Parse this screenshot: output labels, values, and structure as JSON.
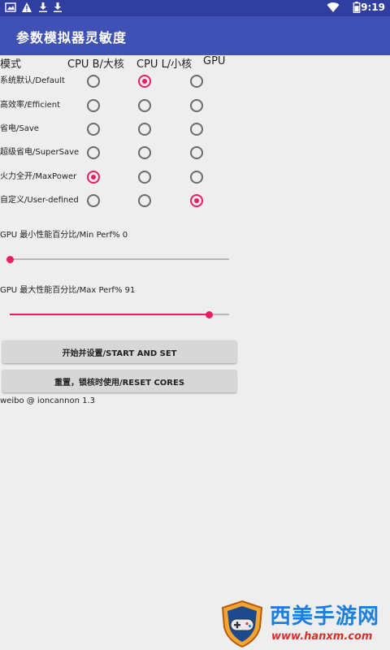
{
  "status_bar": {
    "time": "9:19",
    "left_icons": [
      "image-icon",
      "warning-icon",
      "download-icon",
      "download-icon"
    ],
    "right_icons": [
      "wifi-icon",
      "battery-icon"
    ]
  },
  "app_bar": {
    "title": "参数模拟器灵敏度"
  },
  "mode_table": {
    "headers": [
      "模式",
      "CPU B/大核",
      "CPU L/小核",
      "GPU"
    ],
    "rows": [
      {
        "label": "系统默认/Default",
        "selected": [
          false,
          true,
          false
        ]
      },
      {
        "label": "高效率/Efficient",
        "selected": [
          false,
          false,
          false
        ]
      },
      {
        "label": "省电/Save",
        "selected": [
          false,
          false,
          false
        ]
      },
      {
        "label": "超级省电/SuperSave",
        "selected": [
          false,
          false,
          false
        ]
      },
      {
        "label": "火力全开/MaxPower",
        "selected": [
          true,
          false,
          false
        ]
      },
      {
        "label": "自定义/User-defined",
        "selected": [
          false,
          false,
          true
        ]
      }
    ]
  },
  "sliders": [
    {
      "label": "GPU 最小性能百分比/Min Perf% 0",
      "value_percent": 0
    },
    {
      "label": "GPU 最大性能百分比/Max Perf% 91",
      "value_percent": 91
    }
  ],
  "buttons": {
    "start_set": "开始并设置/START AND SET",
    "reset_cores": "重置，锁核时使用/RESET CORES"
  },
  "footer": {
    "version": "weibo @ ioncannon 1.3"
  },
  "watermark": {
    "name": "西美手游网",
    "url": "www.hanxm.com"
  },
  "colors": {
    "status_bar": "#303f9f",
    "app_bar": "#3f51b5",
    "accent": "#e91e63",
    "background": "#eeeeee"
  }
}
